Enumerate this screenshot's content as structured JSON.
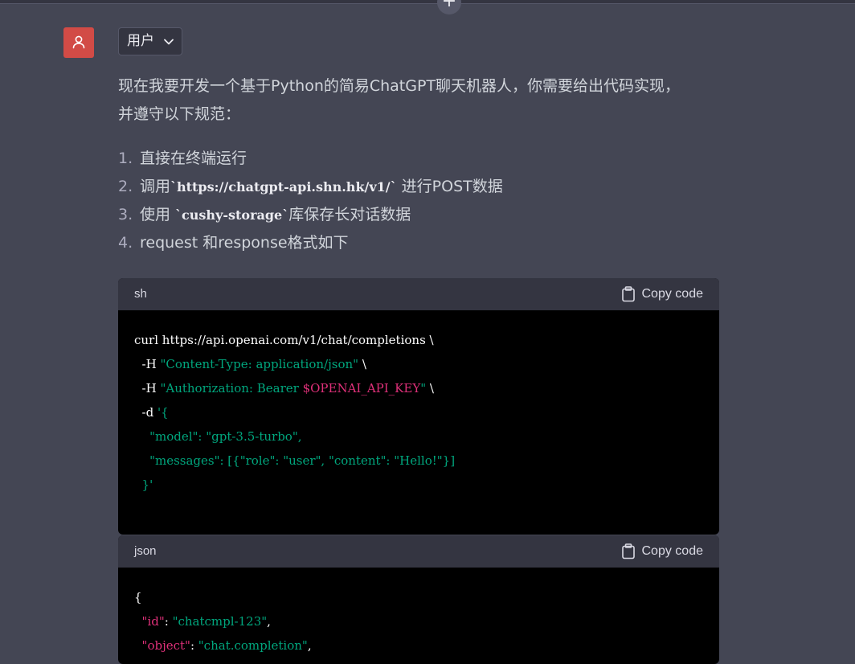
{
  "top": {
    "plus_glyph": "+"
  },
  "user": {
    "role_label": "用户",
    "avatar_icon": "user-icon",
    "avatar_color": "#d24b46"
  },
  "message": {
    "intro_line1": "现在我要开发一个基于Python的简易ChatGPT聊天机器人，你需要给出代码实现，",
    "intro_line2": "并遵守以下规范：",
    "list": [
      {
        "num": "1.",
        "text": "直接在终端运行"
      },
      {
        "num": "2.",
        "pre": "调用",
        "code": "`https://chatgpt-api.shn.hk/v1/`",
        "post": " 进行POST数据"
      },
      {
        "num": "3.",
        "pre": "使用 ",
        "code": "`cushy-storage`",
        "post": "库保存长对话数据"
      },
      {
        "num": "4.",
        "text": "request 和response格式如下"
      }
    ]
  },
  "code_blocks": [
    {
      "lang": "sh",
      "copy_label": "Copy code",
      "lines": [
        [
          {
            "t": "curl https://api.openai.com/v1/chat/completions \\",
            "c": "p"
          }
        ],
        [
          {
            "t": "  -H ",
            "c": "p"
          },
          {
            "t": "\"Content-Type: application/json\"",
            "c": "s"
          },
          {
            "t": " \\",
            "c": "p"
          }
        ],
        [
          {
            "t": "  -H ",
            "c": "p"
          },
          {
            "t": "\"Authorization: Bearer ",
            "c": "s"
          },
          {
            "t": "$OPENAI_API_KEY",
            "c": "v"
          },
          {
            "t": "\"",
            "c": "s"
          },
          {
            "t": " \\",
            "c": "p"
          }
        ],
        [
          {
            "t": "  -d ",
            "c": "p"
          },
          {
            "t": "'{",
            "c": "s"
          }
        ],
        [
          {
            "t": "    \"model\": \"gpt-3.5-turbo\",",
            "c": "s"
          }
        ],
        [
          {
            "t": "    \"messages\": [{\"role\": \"user\", \"content\": \"Hello!\"}]",
            "c": "s"
          }
        ],
        [
          {
            "t": "  }'",
            "c": "s"
          }
        ]
      ]
    },
    {
      "lang": "json",
      "copy_label": "Copy code",
      "lines": [
        [
          {
            "t": "{",
            "c": "p"
          }
        ],
        [
          {
            "t": "  ",
            "c": "p"
          },
          {
            "t": "\"id\"",
            "c": "k"
          },
          {
            "t": ": ",
            "c": "p"
          },
          {
            "t": "\"chatcmpl-123\"",
            "c": "s"
          },
          {
            "t": ",",
            "c": "p"
          }
        ],
        [
          {
            "t": "  ",
            "c": "p"
          },
          {
            "t": "\"object\"",
            "c": "k"
          },
          {
            "t": ": ",
            "c": "p"
          },
          {
            "t": "\"chat.completion\"",
            "c": "s"
          },
          {
            "t": ",",
            "c": "p"
          }
        ]
      ]
    }
  ],
  "colors": {
    "string": "#00a67d",
    "variable": "#df3079",
    "background": "#444654"
  }
}
